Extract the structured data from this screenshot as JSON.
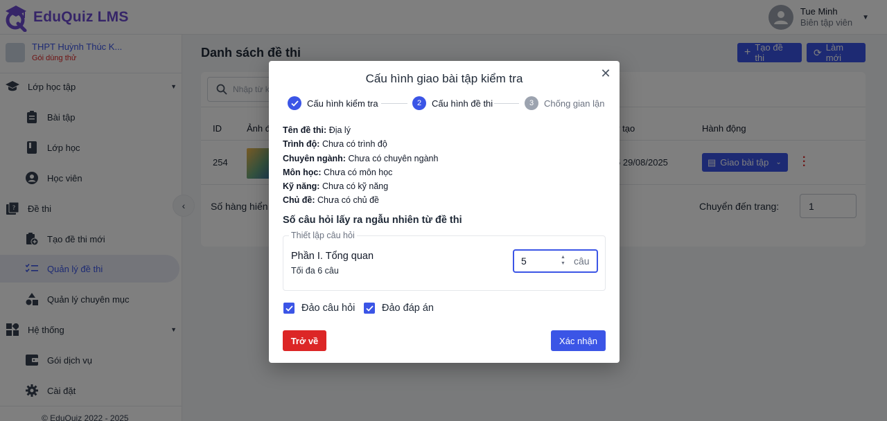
{
  "app": {
    "brand": "EduQuiz LMS",
    "brand_color": "#6d4bd0",
    "accent": "#3b55e6",
    "danger": "#dc2626"
  },
  "user": {
    "name": "Tue Minh",
    "role": "Biên tập viên"
  },
  "school": {
    "name": "THPT Huỳnh Thúc K...",
    "plan": "Gói dùng thử"
  },
  "sidebar": {
    "items": [
      {
        "label": "Lớp học tập",
        "icon": "graduation-cap-icon",
        "type": "group"
      },
      {
        "label": "Bài tập",
        "icon": "clipboard-icon",
        "type": "sub"
      },
      {
        "label": "Lớp học",
        "icon": "book-icon",
        "type": "sub"
      },
      {
        "label": "Học viên",
        "icon": "person-circle-icon",
        "type": "sub"
      },
      {
        "label": "Đề thi",
        "icon": "quiz-icon",
        "type": "group"
      },
      {
        "label": "Tạo đề thi mới",
        "icon": "add-document-icon",
        "type": "sub"
      },
      {
        "label": "Quản lý đề thi",
        "icon": "checklist-icon",
        "type": "sub",
        "active": true
      },
      {
        "label": "Quản lý chuyên mục",
        "icon": "category-icon",
        "type": "sub"
      },
      {
        "label": "Hệ thống",
        "icon": "dashboard-icon",
        "type": "group"
      },
      {
        "label": "Gói dịch vụ",
        "icon": "wallet-icon",
        "type": "sub"
      },
      {
        "label": "Cài đặt",
        "icon": "gear-icon",
        "type": "sub"
      }
    ],
    "copyright": "© EduQuiz 2022 - 2025"
  },
  "main": {
    "title": "Danh sách đề thi",
    "create_button": "Tạo đề thi",
    "refresh_button": "Làm mới",
    "search_placeholder": "Nhập từ k",
    "columns": {
      "id": "ID",
      "image": "Ảnh đ",
      "created": "y tạo",
      "actions": "Hành động"
    },
    "row": {
      "id": "254",
      "created": "5 29/08/2025",
      "assign": "Giao bài tập"
    },
    "rows_label": "Số hàng hiển",
    "goto_label": "Chuyển đến trang:",
    "goto_value": "1"
  },
  "modal": {
    "title": "Cấu hình giao bài tập kiểm tra",
    "steps": [
      {
        "num": "1",
        "label": "Cấu hình kiểm tra",
        "state": "done"
      },
      {
        "num": "2",
        "label": "Cấu hình đề thi",
        "state": "active"
      },
      {
        "num": "3",
        "label": "Chống gian lận",
        "state": "pending"
      }
    ],
    "info": [
      {
        "key": "Tên đề thi:",
        "value": "Địa lý"
      },
      {
        "key": "Trình độ:",
        "value": "Chưa có trình độ"
      },
      {
        "key": "Chuyên ngành:",
        "value": "Chưa có chuyên ngành"
      },
      {
        "key": "Môn học:",
        "value": "Chưa có môn học"
      },
      {
        "key": "Kỹ năng:",
        "value": "Chưa có kỹ năng"
      },
      {
        "key": "Chủ đề:",
        "value": "Chưa có chủ đề"
      }
    ],
    "section_title": "Số câu hỏi lấy ra ngẫu nhiên từ đề thi",
    "fieldset_legend": "Thiết lập câu hỏi",
    "part_name": "Phần I. Tổng quan",
    "part_max": "Tối đa 6 câu",
    "count_value": "5",
    "count_unit": "câu",
    "shuffle_questions": "Đảo câu hỏi",
    "shuffle_answers": "Đảo đáp án",
    "back_button": "Trở về",
    "confirm_button": "Xác nhận"
  }
}
